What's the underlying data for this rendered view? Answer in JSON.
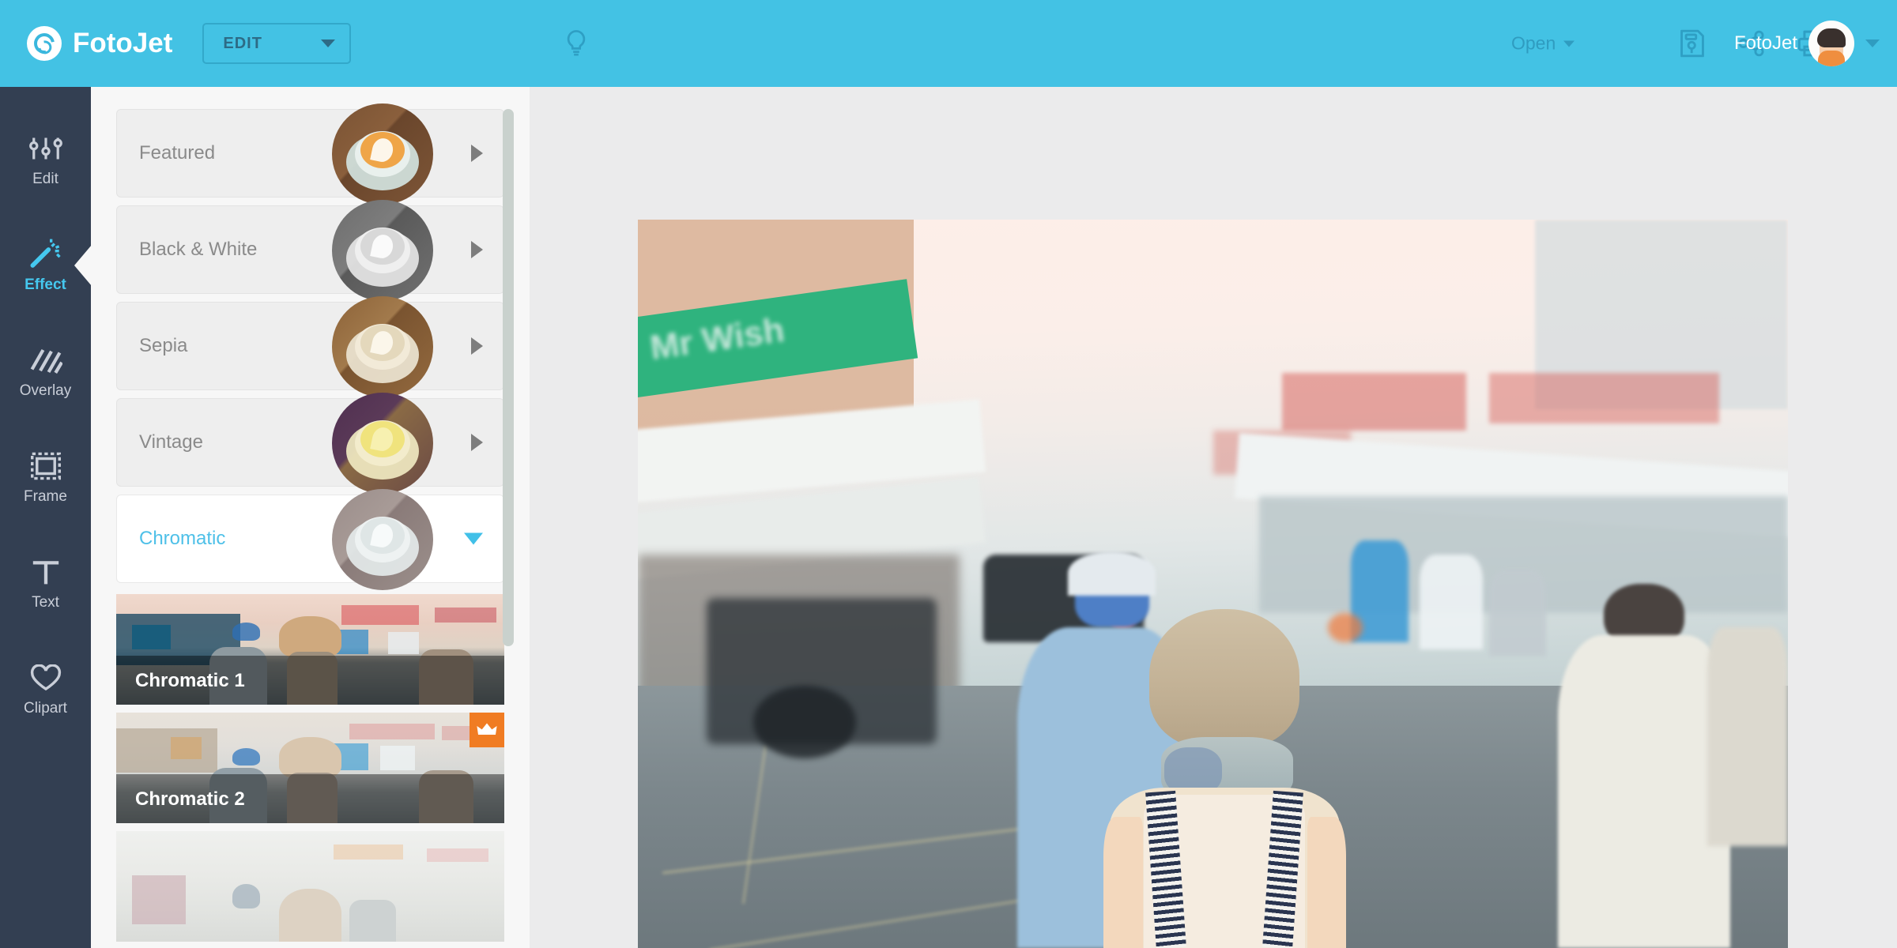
{
  "header": {
    "brand": "FotoJet",
    "mode_label": "EDIT",
    "tips_icon": "lightbulb-icon",
    "open_label": "Open",
    "save_icon": "save-icon",
    "share_icon": "share-icon",
    "print_icon": "print-icon",
    "user_name": "FotoJet",
    "accent_color": "#43c2e4"
  },
  "rail": {
    "items": [
      {
        "label": "Edit",
        "icon": "sliders-icon",
        "active": false
      },
      {
        "label": "Effect",
        "icon": "magic-wand-icon",
        "active": true
      },
      {
        "label": "Overlay",
        "icon": "hatch-icon",
        "active": false
      },
      {
        "label": "Frame",
        "icon": "frame-icon",
        "active": false
      },
      {
        "label": "Text",
        "icon": "text-t-icon",
        "active": false
      },
      {
        "label": "Clipart",
        "icon": "heart-icon",
        "active": false
      }
    ],
    "background_color": "#333f52",
    "active_color": "#45c8ef"
  },
  "effect_panel": {
    "categories": [
      {
        "label": "Featured",
        "expanded": false,
        "arrow": "chevron-right-icon"
      },
      {
        "label": "Black & White",
        "expanded": false,
        "arrow": "chevron-right-icon"
      },
      {
        "label": "Sepia",
        "expanded": false,
        "arrow": "chevron-right-icon"
      },
      {
        "label": "Vintage",
        "expanded": false,
        "arrow": "chevron-right-icon"
      },
      {
        "label": "Chromatic",
        "expanded": true,
        "arrow": "chevron-down-icon"
      }
    ],
    "presets": [
      {
        "label": "Chromatic 1",
        "premium": false
      },
      {
        "label": "Chromatic 2",
        "premium": true,
        "badge_icon": "crown-icon",
        "badge_color": "#f07c23"
      },
      {
        "label": "",
        "premium": false
      }
    ],
    "background_color": "#f7f7f7"
  },
  "canvas": {
    "background_color": "#ebebec",
    "image_description": "blurred street scene with woman from behind wearing backpack"
  }
}
